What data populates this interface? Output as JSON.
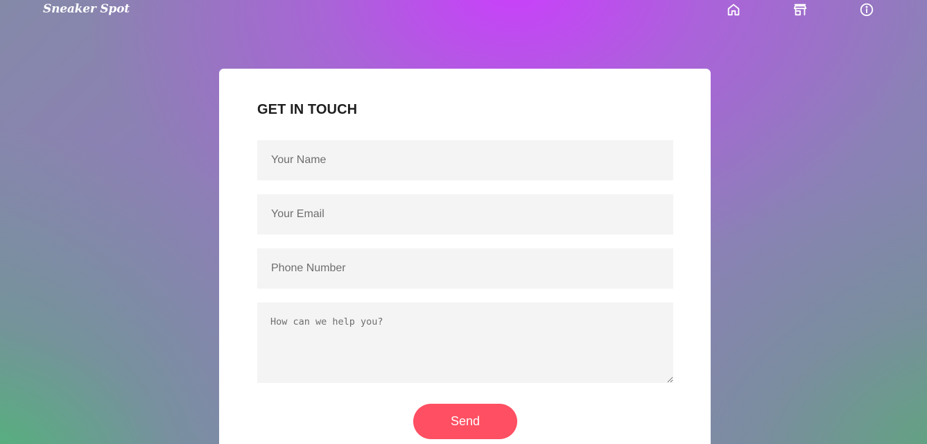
{
  "header": {
    "logo_text": "Sneaker Spot",
    "nav": [
      {
        "icon": "home-icon"
      },
      {
        "icon": "store-icon"
      },
      {
        "icon": "info-icon"
      }
    ]
  },
  "contact_form": {
    "title": "GET IN TOUCH",
    "name_placeholder": "Your Name",
    "email_placeholder": "Your Email",
    "phone_placeholder": "Phone Number",
    "message_placeholder": "How can we help you?",
    "send_label": "Send"
  },
  "colors": {
    "accent": "#ff4f62",
    "card": "#ffffff",
    "field_background": "#f4f4f4",
    "title": "#1e1e1e"
  }
}
